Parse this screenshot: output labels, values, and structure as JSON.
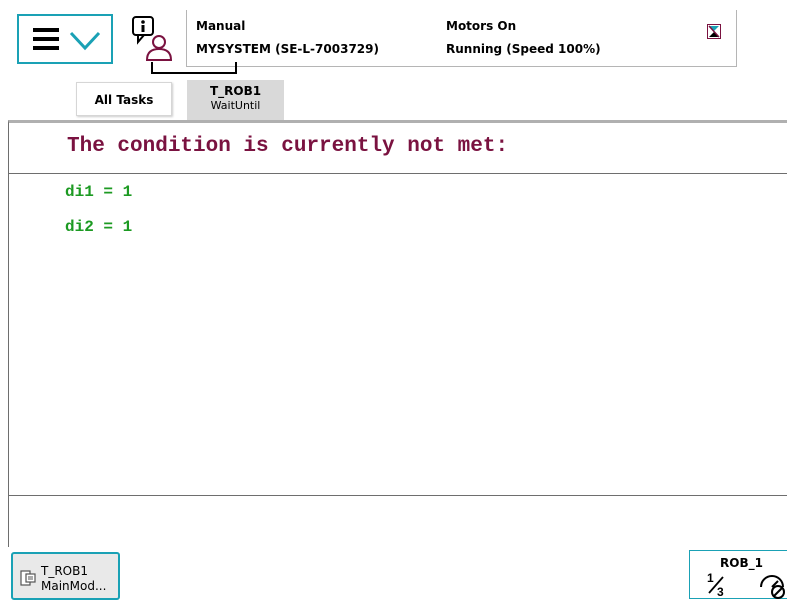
{
  "header": {
    "mode": "Manual",
    "system": "MYSYSTEM (SE-L-7003729)",
    "motors": "Motors On",
    "program_state": "Running (Speed 100%)"
  },
  "icons": {
    "menu": "hamburger-icon",
    "menu_expand": "chevron-down-icon",
    "event_log": "info-user-icon",
    "tool": "tool-icon",
    "task_module": "module-icon",
    "increment": "fraction-icon",
    "speed": "speed-icon"
  },
  "tabs": [
    {
      "label": "All Tasks",
      "sublabel": ""
    },
    {
      "label": "T_ROB1",
      "sublabel": "WaitUntil"
    }
  ],
  "main": {
    "title": "The condition is currently not met:",
    "conditions": [
      "di1 = 1",
      "di2 = 1"
    ]
  },
  "footer": {
    "task_line1": "T_ROB1",
    "task_line2": "MainMod...",
    "robot_label": "ROB_1"
  },
  "colors": {
    "accent": "#1aa1b5",
    "title": "#7a1240",
    "condition": "#1c9a22"
  }
}
